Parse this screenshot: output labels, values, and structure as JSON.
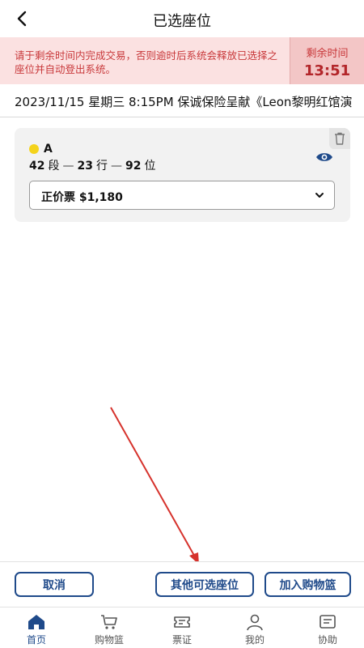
{
  "header": {
    "title": "已选座位"
  },
  "timer_bar": {
    "message": "请于剩余时间内完成交易，否则逾时后系统会释放已选择之座位并自动登出系统。",
    "label": "剩余时间",
    "value": "13:51"
  },
  "event": {
    "info": "2023/11/15 星期三 8:15PM 保诚保险呈献《Leon黎明红馆演"
  },
  "seat": {
    "zone": "A",
    "section": "42",
    "section_unit": "段",
    "row": "23",
    "row_unit": "行",
    "seat_no": "92",
    "seat_unit": "位",
    "separator": "—",
    "price_option": "正价票 $1,180",
    "zone_color": "#f4d31c"
  },
  "actions": {
    "cancel": "取消",
    "other_seats": "其他可选座位",
    "add_to_cart": "加入购物篮"
  },
  "tabs": [
    {
      "label": "首页",
      "icon": "home-icon",
      "active": true
    },
    {
      "label": "购物篮",
      "icon": "cart-icon",
      "active": false
    },
    {
      "label": "票证",
      "icon": "ticket-icon",
      "active": false
    },
    {
      "label": "我的",
      "icon": "user-icon",
      "active": false
    },
    {
      "label": "协助",
      "icon": "help-icon",
      "active": false
    }
  ],
  "colors": {
    "accent": "#1f4a8a",
    "alert": "#c8383a",
    "alert_bg": "#fbe1e1",
    "annotation_arrow": "#d6322c"
  }
}
